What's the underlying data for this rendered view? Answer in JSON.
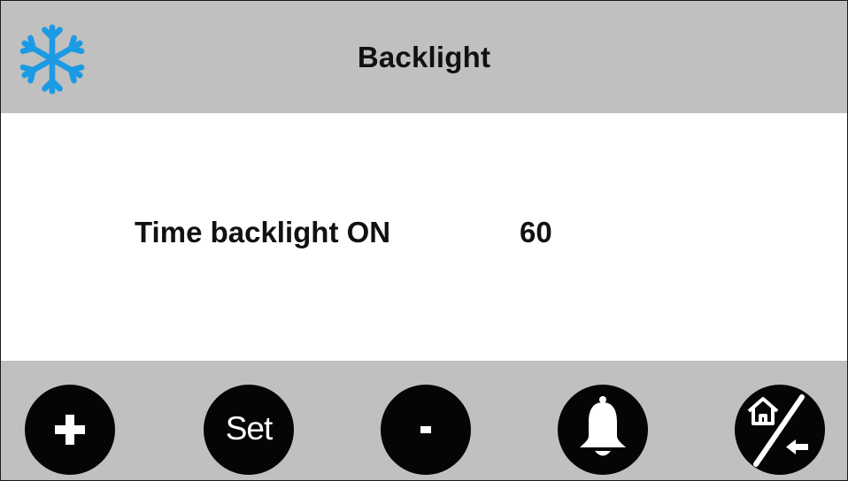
{
  "header": {
    "title": "Backlight",
    "icon": "snowflake-icon",
    "icon_color": "#1c9be4",
    "background": "#c0c0c0"
  },
  "setting": {
    "label": "Time backlight ON",
    "value": "60"
  },
  "footer": {
    "buttons": [
      {
        "name": "plus-button",
        "icon": "plus-icon"
      },
      {
        "name": "set-button",
        "label": "Set"
      },
      {
        "name": "minus-button",
        "icon": "minus-icon"
      },
      {
        "name": "alarm-button",
        "icon": "bell-icon"
      },
      {
        "name": "home-back-button",
        "icon": "home-back-icon"
      }
    ],
    "button_color": "#050505",
    "background": "#c0c0c0"
  }
}
